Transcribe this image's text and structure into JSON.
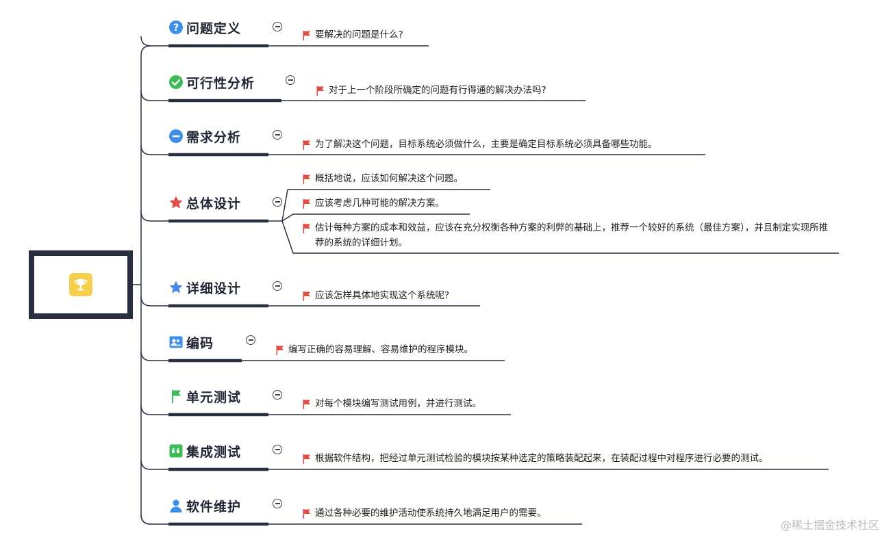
{
  "root": {
    "icon": "trophy-icon"
  },
  "stages": [
    {
      "label": "问题定义",
      "icon": "question-circle-icon",
      "icon_color": "#3b8fe8",
      "notes": [
        "要解决的问题是什么?"
      ]
    },
    {
      "label": "可行性分析",
      "icon": "check-circle-icon",
      "icon_color": "#3dbb57",
      "notes": [
        "对于上一个阶段所确定的问题有行得通的解决办法吗?"
      ]
    },
    {
      "label": "需求分析",
      "icon": "minus-circle-icon",
      "icon_color": "#3b8fe8",
      "notes": [
        "为了解决这个问题，目标系统必须做什么，主要是确定目标系统必须具备哪些功能。"
      ]
    },
    {
      "label": "总体设计",
      "icon": "star-icon",
      "icon_color": "#e04d43",
      "notes": [
        "概括地说，应该如何解决这个问题。",
        "应该考虑几种可能的解决方案。",
        "估计每种方案的成本和效益，应该在充分权衡各种方案的利弊的基础上，推荐一个较好的系统（最佳方案），并且制定实现所推荐的系统的详细计划。"
      ]
    },
    {
      "label": "详细设计",
      "icon": "star-icon",
      "icon_color": "#4a87e8",
      "notes": [
        "应该怎样具体地实现这个系统呢?"
      ]
    },
    {
      "label": "编码",
      "icon": "contacts-icon",
      "icon_color": "#3b8fe8",
      "notes": [
        "编写正确的容易理解、容易维护的程序模块。"
      ]
    },
    {
      "label": "单元测试",
      "icon": "flag-icon",
      "icon_color": "#3dbb57",
      "notes": [
        "对每个模块编写测试用例，并进行测试。"
      ]
    },
    {
      "label": "集成测试",
      "icon": "quote-icon",
      "icon_color": "#3dbb57",
      "notes": [
        "根据软件结构，把经过单元测试检验的模块按某种选定的策略装配起来，在装配过程中对程序进行必要的测试。"
      ]
    },
    {
      "label": "软件维护",
      "icon": "user-icon",
      "icon_color": "#3b8fe8",
      "notes": [
        "通过各种必要的维护活动使系统持久地满足用户的需要。"
      ]
    }
  ],
  "colors": {
    "line": "#28303f",
    "flag": "#e04d43"
  },
  "watermark": "@稀土掘金技术社区"
}
